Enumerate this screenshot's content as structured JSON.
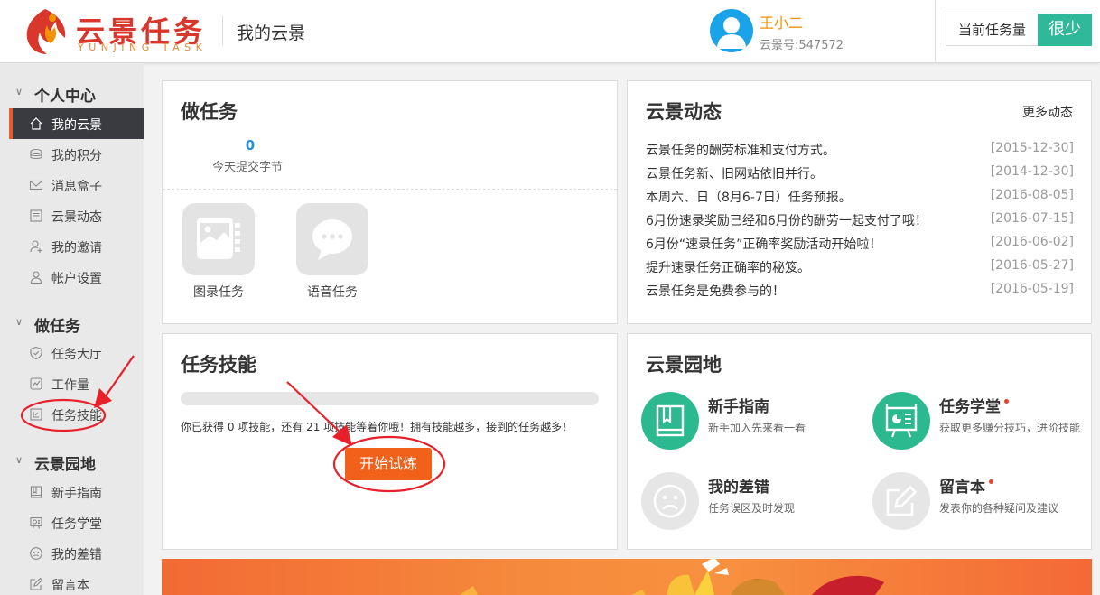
{
  "header": {
    "logo_cn": "云景任务",
    "logo_en": "YUNJING TASK",
    "page_title": "我的云景",
    "user_name": "王小二",
    "user_id": "云景号:547572",
    "task_label": "当前任务量",
    "task_value": "很少"
  },
  "sidebar": {
    "groups": [
      {
        "title": "个人中心",
        "items": [
          {
            "label": "我的云景",
            "icon": "home-icon"
          },
          {
            "label": "我的积分",
            "icon": "coins-icon"
          },
          {
            "label": "消息盒子",
            "icon": "mail-icon"
          },
          {
            "label": "云景动态",
            "icon": "news-icon"
          },
          {
            "label": "我的邀请",
            "icon": "invite-icon"
          },
          {
            "label": "帐户设置",
            "icon": "user-icon"
          }
        ]
      },
      {
        "title": "做任务",
        "items": [
          {
            "label": "任务大厅",
            "icon": "shield-icon"
          },
          {
            "label": "工作量",
            "icon": "chart-icon"
          },
          {
            "label": "任务技能",
            "icon": "skill-icon"
          }
        ]
      },
      {
        "title": "云景园地",
        "items": [
          {
            "label": "新手指南",
            "icon": "book-icon"
          },
          {
            "label": "任务学堂",
            "icon": "board-icon"
          },
          {
            "label": "我的差错",
            "icon": "sad-face-icon"
          },
          {
            "label": "留言本",
            "icon": "edit-icon"
          }
        ]
      }
    ]
  },
  "do_task": {
    "title": "做任务",
    "stat_value": "0",
    "stat_label": "今天提交字节",
    "types": [
      {
        "label": "图录任务",
        "icon": "image-entry-icon"
      },
      {
        "label": "语音任务",
        "icon": "speech-bubble-icon"
      }
    ]
  },
  "news": {
    "title": "云景动态",
    "more": "更多动态",
    "items": [
      {
        "text": "云景任务的酬劳标准和支付方式。",
        "date": "[2015-12-30]"
      },
      {
        "text": "云景任务新、旧网站依旧并行。",
        "date": "[2014-12-30]"
      },
      {
        "text": "本周六、日（8月6-7日）任务预报。",
        "date": "[2016-08-05]"
      },
      {
        "text": "6月份速录奖励已经和6月份的酬劳一起支付了哦！",
        "date": "[2016-07-15]"
      },
      {
        "text": "6月份“速录任务”正确率奖励活动开始啦！",
        "date": "[2016-06-02]"
      },
      {
        "text": "提升速录任务正确率的秘笈。",
        "date": "[2016-05-27]"
      },
      {
        "text": "云景任务是免费参与的！",
        "date": "[2016-05-19]"
      }
    ]
  },
  "skills": {
    "title": "任务技能",
    "progress": 0,
    "text": "你已获得 0 项技能，还有 21 项技能等着你哦！拥有技能越多，接到的任务越多！",
    "button": "开始试炼"
  },
  "garden": {
    "title": "云景园地",
    "items": [
      {
        "title": "新手指南",
        "desc": "新手加入先来看一看",
        "icon": "book-icon",
        "color": "#2db98f",
        "dot": false
      },
      {
        "title": "任务学堂",
        "desc": "获取更多赚分技巧，进阶技能",
        "icon": "board-icon",
        "color": "#2db98f",
        "dot": true
      },
      {
        "title": "我的差错",
        "desc": "任务误区及时发现",
        "icon": "sad-face-icon",
        "color": "#e6e6e6",
        "dot": false
      },
      {
        "title": "留言本",
        "desc": "发表你的各种疑问及建议",
        "icon": "edit-icon",
        "color": "#e6e6e6",
        "dot": true
      }
    ]
  },
  "colors": {
    "accent": "#f2611a",
    "green": "#2fb99a",
    "sidebar_active": "#3a3b40",
    "annotation_red": "#e8202a"
  }
}
